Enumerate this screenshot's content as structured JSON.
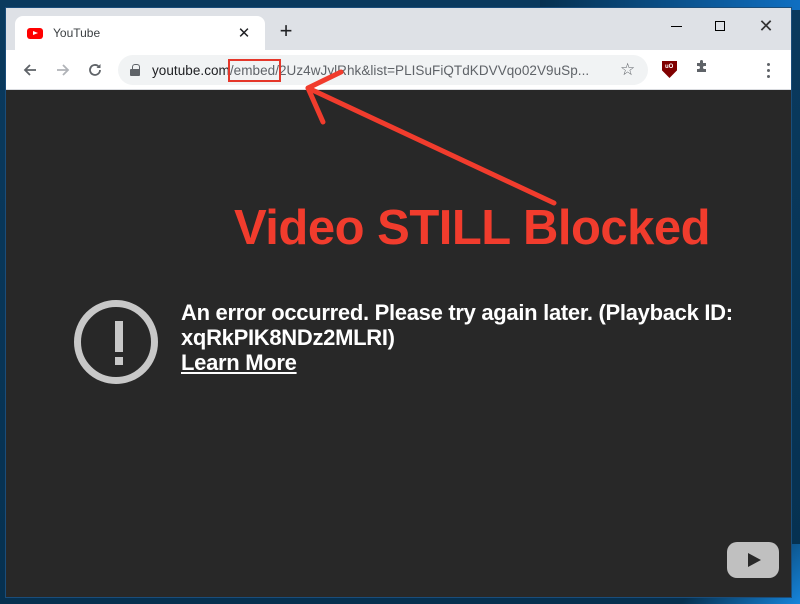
{
  "browser": {
    "tab": {
      "title": "YouTube",
      "favicon": "youtube-icon",
      "close_glyph": "✕"
    },
    "new_tab_glyph": "+",
    "window_controls": {
      "minimize": "minimize-icon",
      "maximize": "maximize-icon",
      "close_glyph": "✕"
    },
    "toolbar": {
      "back_icon": "arrow-left-icon",
      "forward_icon": "arrow-right-icon",
      "reload_icon": "reload-icon",
      "url_host": "youtube.com",
      "url_highlighted": "/embed/",
      "url_rest": "2Uz4wJylRhk&list=PLISuFiQTdKDVVqo02V9uSp...",
      "bookmark_glyph": "☆",
      "extensions": [
        "ublock-origin-icon",
        "puzzle-extensions-icon"
      ],
      "menu_icon": "kebab-menu-icon"
    }
  },
  "player": {
    "error_message_line1": "An error occurred. Please try again later. (Playback ID:",
    "error_message_line2": "xqRkPIK8NDz2MLRI)",
    "learn_more": "Learn More",
    "logo": "youtube-play-icon"
  },
  "annotation": {
    "text": "Video STILL Blocked",
    "color": "#f13c2d"
  },
  "colors": {
    "player_bg": "#282828",
    "tabstrip_bg": "#dee1e6",
    "highlight_red": "#e5372a"
  }
}
